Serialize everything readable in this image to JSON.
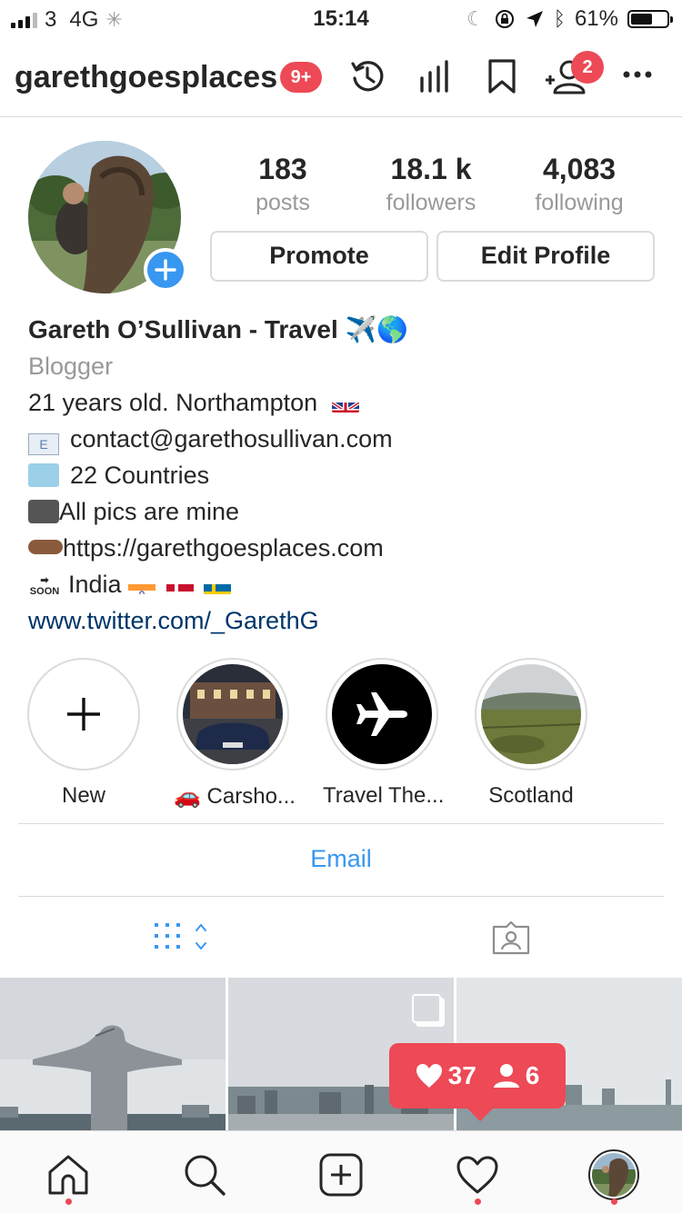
{
  "status_bar": {
    "carrier": "3",
    "network": "4G",
    "time": "15:14",
    "battery": "61%",
    "battery_level": 0.61
  },
  "header": {
    "username": "garethgoesplaces",
    "notifications_badge": "9+",
    "discover_badge": "2"
  },
  "profile": {
    "stats": [
      {
        "value": "183",
        "label": "posts"
      },
      {
        "value": "18.1 k",
        "label": "followers"
      },
      {
        "value": "4,083",
        "label": "following"
      }
    ],
    "promote_label": "Promote",
    "edit_profile_label": "Edit Profile"
  },
  "bio": {
    "name": "Gareth O’Sullivan - Travel ✈️🌎",
    "category": "Blogger",
    "lines": [
      "21 years old. Northampton",
      "contact@garethosullivan.com",
      "22 Countries",
      "All pics are mine",
      "https://garethgoesplaces.com",
      "India"
    ],
    "link": "www.twitter.com/_GarethG"
  },
  "highlights": [
    {
      "label": "New"
    },
    {
      "label": "🚗 Carsho..."
    },
    {
      "label": "Travel The..."
    },
    {
      "label": "Scotland"
    }
  ],
  "contact_button": "Email",
  "tooltip": {
    "likes": "37",
    "followers": "6"
  },
  "colors": {
    "accent": "#3897f0",
    "badge": "#ed4956",
    "link": "#003569"
  }
}
